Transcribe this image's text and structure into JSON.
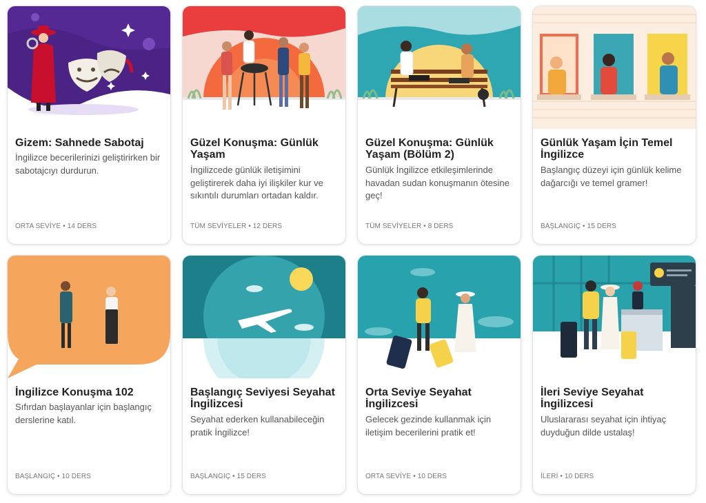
{
  "courses": [
    {
      "title": "Gizem: Sahnede Sabotaj",
      "description": "İngilizce becerilerinizi geliştirirken bir sabotajcıyı durdurun.",
      "level": "ORTA SEVİYE",
      "lessons": "14 DERS"
    },
    {
      "title": "Güzel Konuşma: Günlük Yaşam",
      "description": "İngilizcede günlük iletişimini geliştirerek daha iyi ilişkiler kur ve sıkıntılı durumları ortadan kaldır.",
      "level": "TÜM SEVİYELER",
      "lessons": "12 DERS"
    },
    {
      "title": "Güzel Konuşma: Günlük Yaşam (Bölüm 2)",
      "description": "Günlük İngilizce etkileşimlerinde havadan sudan konuşmanın ötesine geç!",
      "level": "TÜM SEVİYELER",
      "lessons": "8 DERS"
    },
    {
      "title": "Günlük Yaşam İçin Temel İngilizce",
      "description": "Başlangıç düzeyi için günlük kelime dağarcığı ve temel gramer!",
      "level": "BAŞLANGIÇ",
      "lessons": "15 DERS"
    },
    {
      "title": "İngilizce Konuşma 102",
      "description": "Sıfırdan başlayanlar için başlangıç derslerine katıl.",
      "level": "BAŞLANGIÇ",
      "lessons": "10 DERS"
    },
    {
      "title": "Başlangıç Seviyesi Seyahat İngilizcesi",
      "description": "Seyahat ederken kullanabileceğin pratik İngilizce!",
      "level": "BAŞLANGIÇ",
      "lessons": "15 DERS"
    },
    {
      "title": "Orta Seviye Seyahat İngilizcesi",
      "description": "Gelecek gezinde kullanmak için iletişim becerilerini pratik et!",
      "level": "ORTA SEVİYE",
      "lessons": "10 DERS"
    },
    {
      "title": "İleri Seviye Seyahat İngilizcesi",
      "description": "Uluslararası seyahat için ihtiyaç duyduğun dilde ustalaş!",
      "level": "İLERİ",
      "lessons": "10 DERS"
    }
  ],
  "meta_separator": "•"
}
